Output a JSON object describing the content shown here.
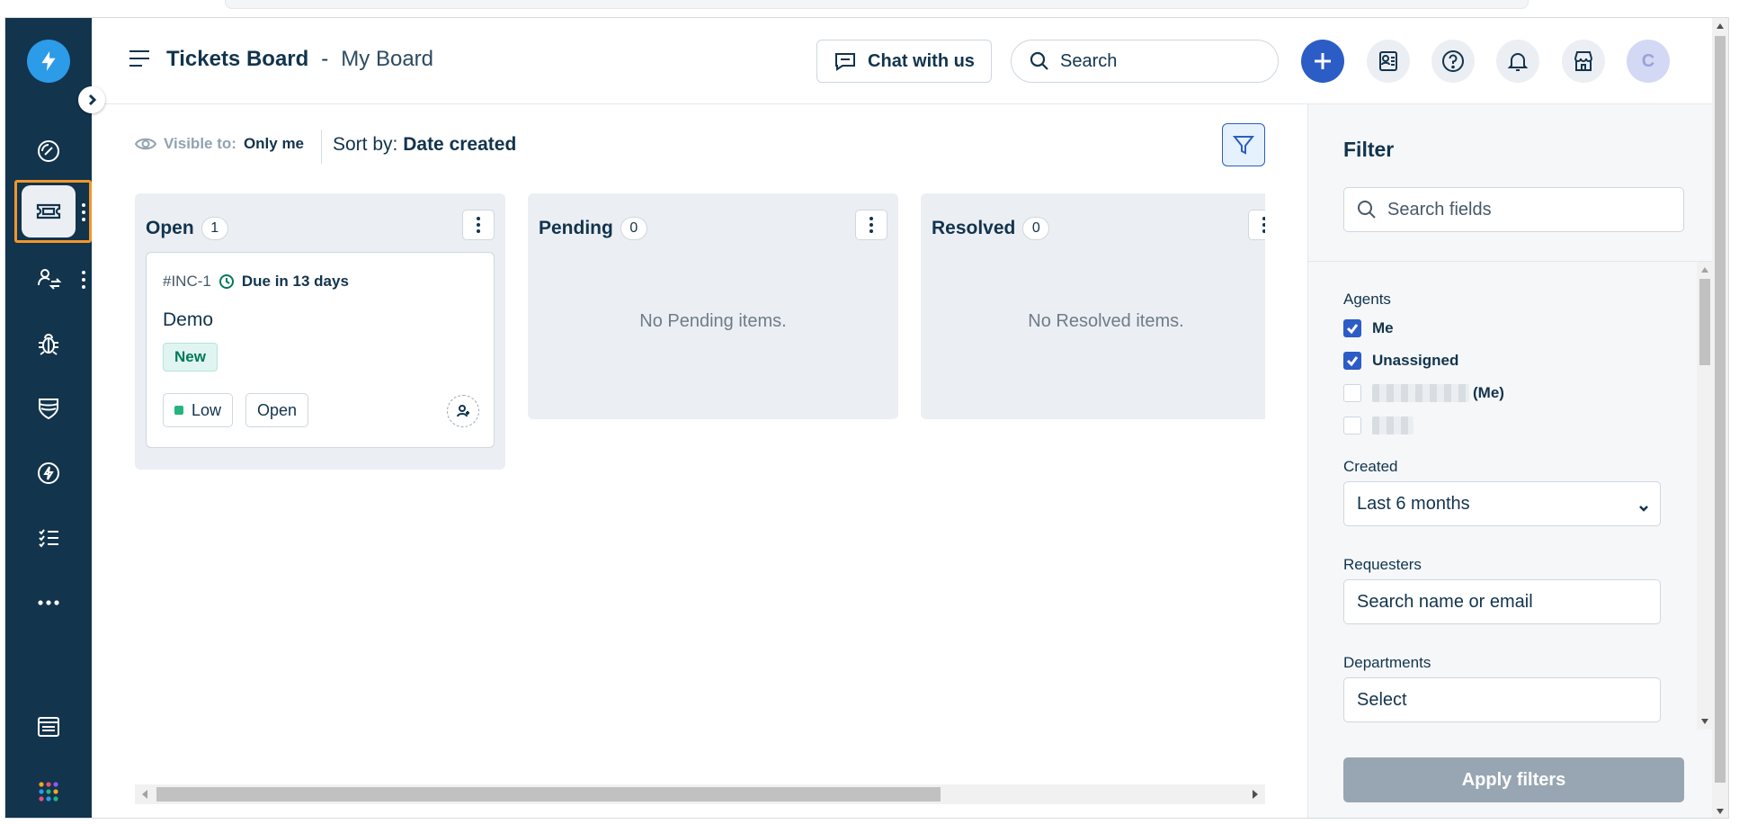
{
  "header": {
    "title": "Tickets Board",
    "separator": "-",
    "board_name": "My Board",
    "chat_label": "Chat with us",
    "search_placeholder": "Search",
    "avatar_initial": "C"
  },
  "toolbar": {
    "visible_label": "Visible to:",
    "visible_value": "Only me",
    "sort_label": "Sort by:",
    "sort_value": "Date created"
  },
  "columns": [
    {
      "name": "Open",
      "count": "1",
      "empty_text": ""
    },
    {
      "name": "Pending",
      "count": "0",
      "empty_text": "No Pending items."
    },
    {
      "name": "Resolved",
      "count": "0",
      "empty_text": "No Resolved items."
    }
  ],
  "card": {
    "id": "#INC-1",
    "due": "Due in 13 days",
    "title": "Demo",
    "status": "New",
    "priority": "Low",
    "state": "Open"
  },
  "filter": {
    "title": "Filter",
    "search_placeholder": "Search fields",
    "agents_label": "Agents",
    "agents": [
      {
        "label": "Me",
        "checked": true
      },
      {
        "label": "Unassigned",
        "checked": true
      },
      {
        "label": "(Me)",
        "checked": false
      },
      {
        "label": "",
        "checked": false
      }
    ],
    "created_label": "Created",
    "created_value": "Last 6 months",
    "requesters_label": "Requesters",
    "requesters_placeholder": "Search name or email",
    "departments_label": "Departments",
    "departments_value": "Select",
    "apply_label": "Apply filters"
  },
  "colors": {
    "nav_bg": "#12344d",
    "accent": "#2c5cc5",
    "active_outline": "#f2962a",
    "status_green": "#00795b"
  },
  "icons": {
    "nav": [
      "dashboard-icon",
      "tickets-icon",
      "changes-icon",
      "bug-icon",
      "shield-icon",
      "lightning-icon",
      "tasks-icon",
      "more-icon",
      "admin-icon",
      "apps-icon"
    ],
    "header": [
      "hamburger-icon",
      "chat-icon",
      "search-icon",
      "add-icon",
      "contacts-icon",
      "help-icon",
      "bell-icon",
      "store-icon"
    ]
  }
}
